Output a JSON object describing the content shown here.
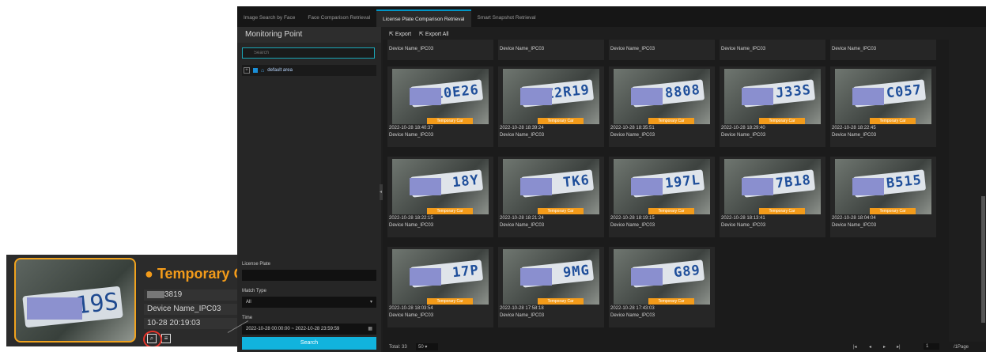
{
  "tabs": [
    {
      "label": "Image Search by Face",
      "active": false
    },
    {
      "label": "Face Comparison Retrieval",
      "active": false
    },
    {
      "label": "License Plate Comparison Retrieval",
      "active": true
    },
    {
      "label": "Smart Snapshot Retrieval",
      "active": false
    }
  ],
  "sidebar": {
    "title": "Monitoring Point",
    "search_placeholder": "Search",
    "tree_item": "default area",
    "plate_label": "License Plate",
    "plate_value": "",
    "match_label": "Match Type",
    "match_value": "All",
    "time_label": "Time",
    "time_value": "2022-10-28 00:00:00 ~ 2022-10-28 23:59:59",
    "search_button": "Search"
  },
  "toolbar": {
    "export": "Export",
    "export_all": "Export All"
  },
  "top_partial_cards": [
    {
      "device": "Device Name_IPC03"
    },
    {
      "device": "Device Name_IPC03"
    },
    {
      "device": "Device Name_IPC03"
    },
    {
      "device": "Device Name_IPC03"
    },
    {
      "device": "Device Name_IPC03"
    }
  ],
  "results": [
    {
      "plate": "L0E26",
      "badge": "Temporary Car",
      "time": "2022-10-28 18:40:37",
      "device": "Device Name_IPC03"
    },
    {
      "plate": "Z2R19",
      "badge": "Temporary Car",
      "time": "2022-10-28 18:39:24",
      "device": "Device Name_IPC03"
    },
    {
      "plate": "8808",
      "badge": "Temporary Car",
      "time": "2022-10-28 18:35:51",
      "device": "Device Name_IPC03"
    },
    {
      "plate": "J33S",
      "badge": "Temporary Car",
      "time": "2022-10-28 18:29:40",
      "device": "Device Name_IPC03"
    },
    {
      "plate": "C057",
      "badge": "Temporary Car",
      "time": "2022-10-28 18:22:45",
      "device": "Device Name_IPC03"
    },
    {
      "plate": "18Y",
      "badge": "Temporary Car",
      "time": "2022-10-28 18:22:15",
      "device": "Device Name_IPC03"
    },
    {
      "plate": "TK6",
      "badge": "Temporary Car",
      "time": "2022-10-28 18:21:24",
      "device": "Device Name_IPC03"
    },
    {
      "plate": "197L",
      "badge": "Temporary Car",
      "time": "2022-10-28 18:19:15",
      "device": "Device Name_IPC03"
    },
    {
      "plate": "7B18",
      "badge": "Temporary Car",
      "time": "2022-10-28 18:13:41",
      "device": "Device Name_IPC03"
    },
    {
      "plate": "B515",
      "badge": "Temporary Car",
      "time": "2022-10-28 18:04:04",
      "device": "Device Name_IPC03"
    },
    {
      "plate": "17P",
      "badge": "Temporary Car",
      "time": "2022-10-28 18:03:54",
      "device": "Device Name_IPC03"
    },
    {
      "plate": "9MG",
      "badge": "Temporary Car",
      "time": "2022-10-28 17:58:18",
      "device": "Device Name_IPC03"
    },
    {
      "plate": "G89",
      "badge": "Temporary Car",
      "time": "2022-10-28 17:43:03",
      "device": "Device Name_IPC03"
    }
  ],
  "pagination": {
    "total": "Total: 33",
    "page_size": "50",
    "page": "1",
    "pages": "/1Page"
  },
  "inset": {
    "title": "Temporary C",
    "plate_suffix": "3819",
    "device": "Device Name_IPC03",
    "time": "10-28 20:19:03",
    "thumb_plate": "19S"
  },
  "colors": {
    "accent": "#11b3dd",
    "badge": "#f39b1a",
    "highlight_ring": "#e6332a"
  }
}
